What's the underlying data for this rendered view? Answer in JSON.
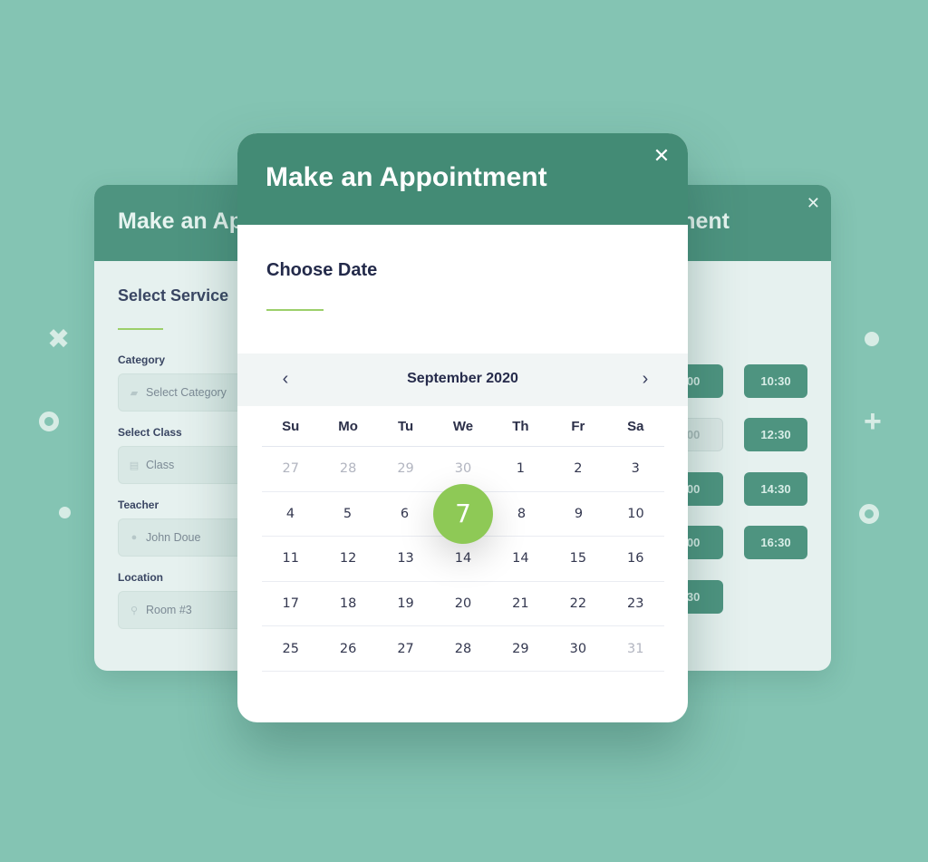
{
  "background": {
    "color": "#84c4b3"
  },
  "colors": {
    "header_green": "#438b75",
    "accent_green": "#8ec956",
    "underline_green": "#9ccf6a",
    "slot_green": "#4e9480"
  },
  "back_left_card": {
    "title": "Make an Ap",
    "subtitle": "Select Service",
    "fields": [
      {
        "label": "Category",
        "icon": "graduation-cap-icon",
        "value": "Select Category"
      },
      {
        "label": "Select Class",
        "icon": "class-icon",
        "value": "Class"
      },
      {
        "label": "Teacher",
        "icon": "user-icon",
        "value": "John Doue"
      },
      {
        "label": "Location",
        "icon": "location-pin-icon",
        "value": "Room #3"
      }
    ]
  },
  "back_right_card": {
    "title": "nent",
    "close_icon": "close-icon",
    "time_slots": [
      {
        "label": ":00",
        "state": "available"
      },
      {
        "label": "10:30",
        "state": "available"
      },
      {
        "label": ":00",
        "state": "disabled"
      },
      {
        "label": "12:30",
        "state": "available"
      },
      {
        "label": ":00",
        "state": "available"
      },
      {
        "label": "14:30",
        "state": "available"
      },
      {
        "label": ":00",
        "state": "available"
      },
      {
        "label": "16:30",
        "state": "available"
      },
      {
        "label": ":30",
        "state": "available"
      }
    ]
  },
  "modal": {
    "title": "Make an Appointment",
    "close_symbol": "✕",
    "section_title": "Choose Date",
    "calendar": {
      "month_label": "September 2020",
      "prev_symbol": "‹",
      "next_symbol": "›",
      "weekdays": [
        "Su",
        "Mo",
        "Tu",
        "We",
        "Th",
        "Fr",
        "Sa"
      ],
      "selected_day": "7",
      "weeks": [
        [
          {
            "d": "27",
            "muted": true
          },
          {
            "d": "28",
            "muted": true
          },
          {
            "d": "29",
            "muted": true
          },
          {
            "d": "30",
            "muted": true
          },
          {
            "d": "1"
          },
          {
            "d": "2"
          },
          {
            "d": "3"
          }
        ],
        [
          {
            "d": "4"
          },
          {
            "d": "5"
          },
          {
            "d": "6"
          },
          {
            "d": "7",
            "selected": true
          },
          {
            "d": "8"
          },
          {
            "d": "9"
          },
          {
            "d": "10"
          }
        ],
        [
          {
            "d": "11"
          },
          {
            "d": "12"
          },
          {
            "d": "13"
          },
          {
            "d": "14"
          },
          {
            "d": "14"
          },
          {
            "d": "15"
          },
          {
            "d": "16"
          }
        ],
        [
          {
            "d": "17"
          },
          {
            "d": "18"
          },
          {
            "d": "19"
          },
          {
            "d": "20"
          },
          {
            "d": "21"
          },
          {
            "d": "22"
          },
          {
            "d": "23"
          }
        ],
        [
          {
            "d": "25"
          },
          {
            "d": "26"
          },
          {
            "d": "27"
          },
          {
            "d": "28"
          },
          {
            "d": "29"
          },
          {
            "d": "30"
          },
          {
            "d": "31",
            "muted": true
          }
        ]
      ]
    }
  }
}
